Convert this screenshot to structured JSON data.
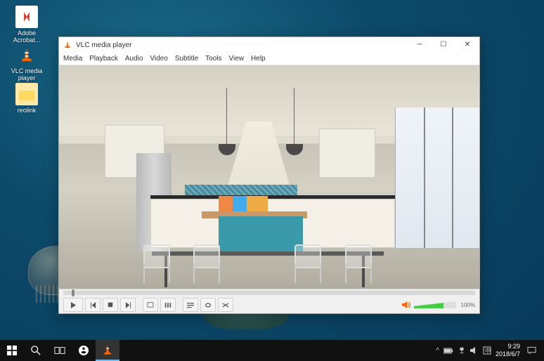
{
  "desktop_icons": {
    "acrobat": "Adobe Acrobat...",
    "vlc": "VLC media player",
    "reolink": "reolink"
  },
  "window": {
    "title": "VLC media player",
    "menu": {
      "media": "Media",
      "playback": "Playback",
      "audio": "Audio",
      "video": "Video",
      "subtitle": "Subtitle",
      "tools": "Tools",
      "view": "View",
      "help": "Help"
    },
    "controls": {
      "volume_label": "100%"
    }
  },
  "taskbar": {
    "clock_time": "9:29",
    "clock_date": "2018/6/7"
  }
}
